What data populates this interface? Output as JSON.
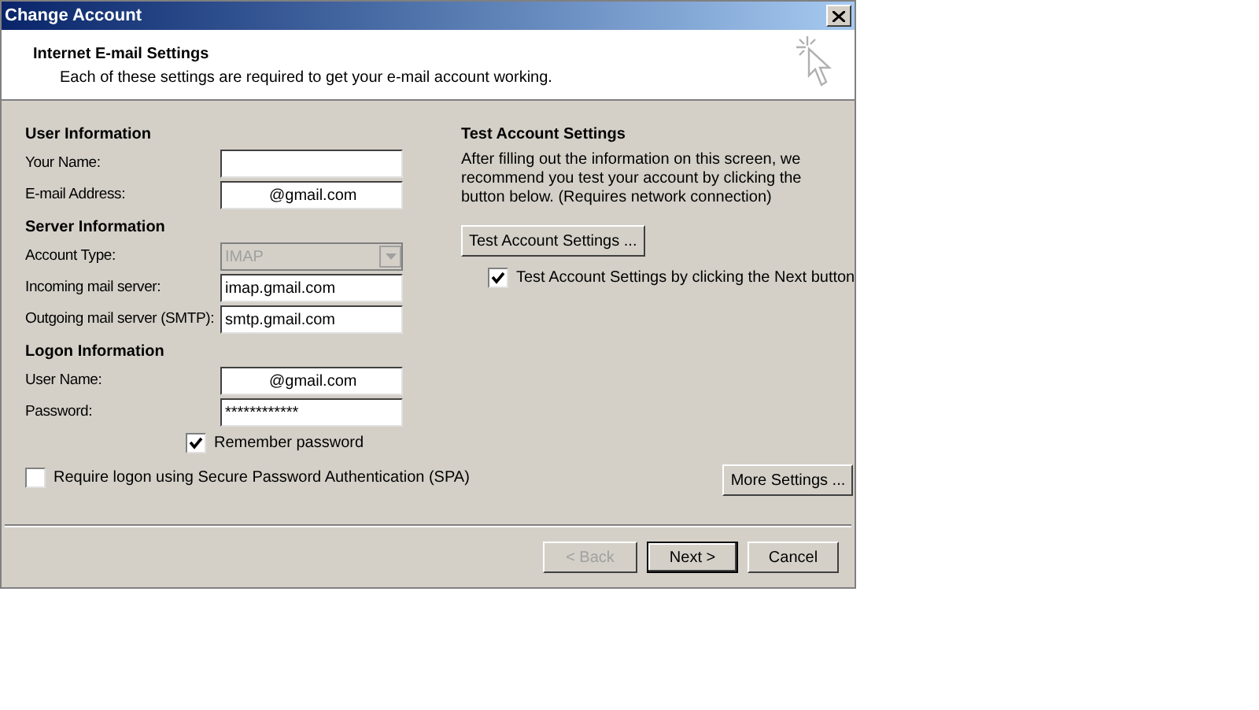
{
  "window": {
    "title": "Change Account"
  },
  "header": {
    "title": "Internet E-mail Settings",
    "subtitle": "Each of these settings are required to get your e-mail account working."
  },
  "left_sections": [
    {
      "title": "User Information",
      "fields": [
        {
          "kind": "text",
          "label": "Your Name:",
          "disabled": false
        },
        {
          "kind": "text",
          "label": "E-mail Address:",
          "value": "@gmail.com",
          "disabled": false
        }
      ]
    },
    {
      "title": "Server Information",
      "fields": [
        {
          "kind": "select",
          "label": "Account Type:",
          "value": "IMAP",
          "disabled": true
        },
        {
          "kind": "text",
          "label": "Incoming mail server:",
          "value": "imap.gmail.com",
          "disabled": false
        },
        {
          "kind": "text",
          "label": "Outgoing mail server (SMTP):",
          "value": "smtp.gmail.com",
          "disabled": false
        }
      ]
    },
    {
      "title": "Logon Information",
      "fields": [
        {
          "kind": "text",
          "label": "User Name:",
          "value": "@gmail.com",
          "disabled": false
        },
        {
          "kind": "text",
          "label": "Password:",
          "value": "************",
          "disabled": false
        }
      ]
    }
  ],
  "remember_password": {
    "label": "Remember password",
    "checked": true
  },
  "spa": {
    "label": "Require logon using Secure Password Authentication (SPA)",
    "checked": false
  },
  "test_section": {
    "title": "Test Account Settings",
    "text": "After filling out the information on this screen, we recommend you test your account by clicking the button below. (Requires network connection)",
    "button": "Test Account Settings ...",
    "checkbox": {
      "label": "Test Account Settings by clicking the Next button",
      "checked": true
    }
  },
  "more_settings_button": "More Settings ...",
  "footer_buttons": [
    {
      "label": "< Back",
      "disabled": true,
      "default": false
    },
    {
      "label": "Next >",
      "disabled": false,
      "default": true
    },
    {
      "label": "Cancel",
      "disabled": false,
      "default": false
    }
  ]
}
